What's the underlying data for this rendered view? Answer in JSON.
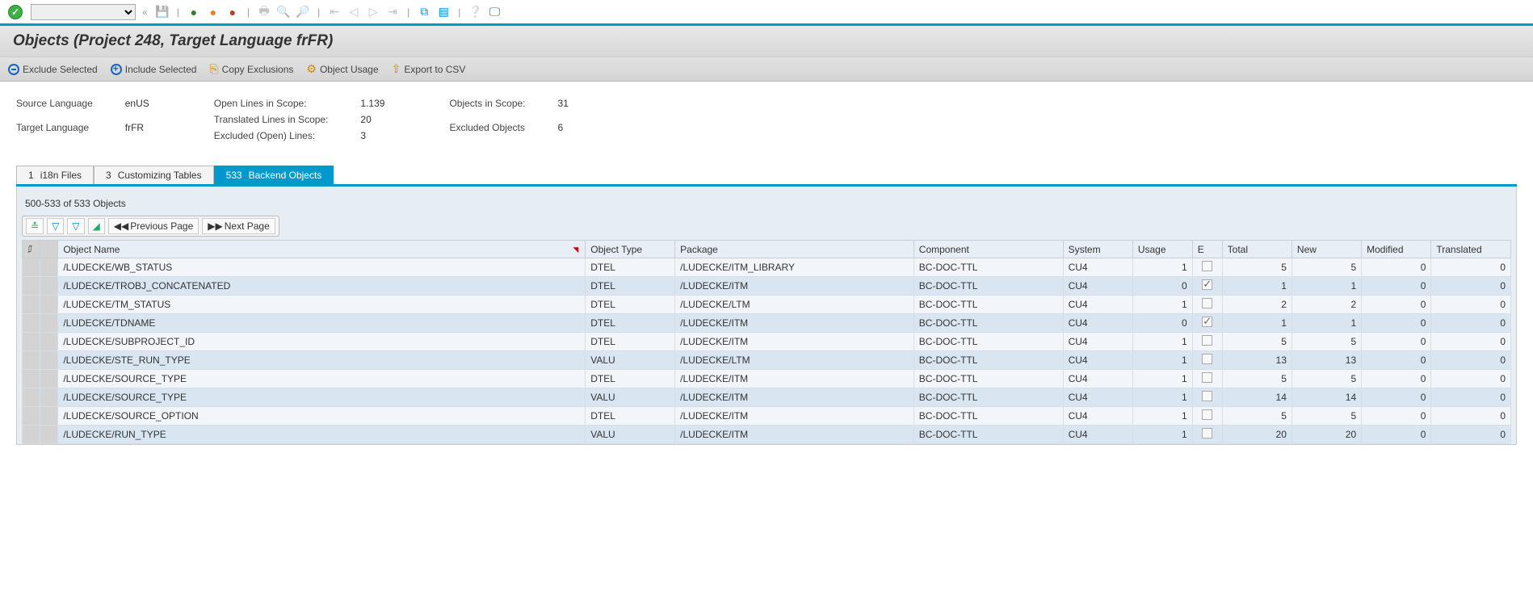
{
  "title": "Objects (Project 248, Target Language frFR)",
  "actions": {
    "exclude": "Exclude Selected",
    "include": "Include Selected",
    "copy": "Copy Exclusions",
    "usage": "Object Usage",
    "export": "Export to CSV"
  },
  "info": {
    "sourceLangLabel": "Source Language",
    "sourceLangVal": "enUS",
    "targetLangLabel": "Target Language",
    "targetLangVal": "frFR",
    "openLinesLabel": "Open Lines in Scope:",
    "openLinesVal": "1.139",
    "translatedLinesLabel": "Translated Lines in Scope:",
    "translatedLinesVal": "20",
    "excludedLinesLabel": "Excluded (Open) Lines:",
    "excludedLinesVal": "3",
    "objectsScopeLabel": "Objects in Scope:",
    "objectsScopeVal": "31",
    "excludedObjectsLabel": "Excluded Objects",
    "excludedObjectsVal": "6"
  },
  "tabs": {
    "i18n_count": "1",
    "i18n_label": "i18n Files",
    "cust_count": "3",
    "cust_label": "Customizing Tables",
    "backend_count": "533",
    "backend_label": "Backend Objects"
  },
  "pager": {
    "range": "500-533 of 533 Objects",
    "prev": "Previous Page",
    "next": "Next Page"
  },
  "columns": {
    "objectName": "Object Name",
    "objectType": "Object Type",
    "package": "Package",
    "component": "Component",
    "system": "System",
    "usage": "Usage",
    "e": "E",
    "total": "Total",
    "new": "New",
    "modified": "Modified",
    "translated": "Translated"
  },
  "rows": [
    {
      "name": "/LUDECKE/WB_STATUS",
      "type": "DTEL",
      "package": "/LUDECKE/ITM_LIBRARY",
      "component": "BC-DOC-TTL",
      "system": "CU4",
      "usage": "1",
      "e": false,
      "total": "5",
      "new": "5",
      "modified": "0",
      "translated": "0"
    },
    {
      "name": "/LUDECKE/TROBJ_CONCATENATED",
      "type": "DTEL",
      "package": "/LUDECKE/ITM",
      "component": "BC-DOC-TTL",
      "system": "CU4",
      "usage": "0",
      "e": true,
      "total": "1",
      "new": "1",
      "modified": "0",
      "translated": "0"
    },
    {
      "name": "/LUDECKE/TM_STATUS",
      "type": "DTEL",
      "package": "/LUDECKE/LTM",
      "component": "BC-DOC-TTL",
      "system": "CU4",
      "usage": "1",
      "e": false,
      "total": "2",
      "new": "2",
      "modified": "0",
      "translated": "0"
    },
    {
      "name": "/LUDECKE/TDNAME",
      "type": "DTEL",
      "package": "/LUDECKE/ITM",
      "component": "BC-DOC-TTL",
      "system": "CU4",
      "usage": "0",
      "e": true,
      "total": "1",
      "new": "1",
      "modified": "0",
      "translated": "0"
    },
    {
      "name": "/LUDECKE/SUBPROJECT_ID",
      "type": "DTEL",
      "package": "/LUDECKE/ITM",
      "component": "BC-DOC-TTL",
      "system": "CU4",
      "usage": "1",
      "e": false,
      "total": "5",
      "new": "5",
      "modified": "0",
      "translated": "0"
    },
    {
      "name": "/LUDECKE/STE_RUN_TYPE",
      "type": "VALU",
      "package": "/LUDECKE/LTM",
      "component": "BC-DOC-TTL",
      "system": "CU4",
      "usage": "1",
      "e": false,
      "total": "13",
      "new": "13",
      "modified": "0",
      "translated": "0"
    },
    {
      "name": "/LUDECKE/SOURCE_TYPE",
      "type": "DTEL",
      "package": "/LUDECKE/ITM",
      "component": "BC-DOC-TTL",
      "system": "CU4",
      "usage": "1",
      "e": false,
      "total": "5",
      "new": "5",
      "modified": "0",
      "translated": "0"
    },
    {
      "name": "/LUDECKE/SOURCE_TYPE",
      "type": "VALU",
      "package": "/LUDECKE/ITM",
      "component": "BC-DOC-TTL",
      "system": "CU4",
      "usage": "1",
      "e": false,
      "total": "14",
      "new": "14",
      "modified": "0",
      "translated": "0"
    },
    {
      "name": "/LUDECKE/SOURCE_OPTION",
      "type": "DTEL",
      "package": "/LUDECKE/ITM",
      "component": "BC-DOC-TTL",
      "system": "CU4",
      "usage": "1",
      "e": false,
      "total": "5",
      "new": "5",
      "modified": "0",
      "translated": "0"
    },
    {
      "name": "/LUDECKE/RUN_TYPE",
      "type": "VALU",
      "package": "/LUDECKE/ITM",
      "component": "BC-DOC-TTL",
      "system": "CU4",
      "usage": "1",
      "e": false,
      "total": "20",
      "new": "20",
      "modified": "0",
      "translated": "0"
    }
  ]
}
